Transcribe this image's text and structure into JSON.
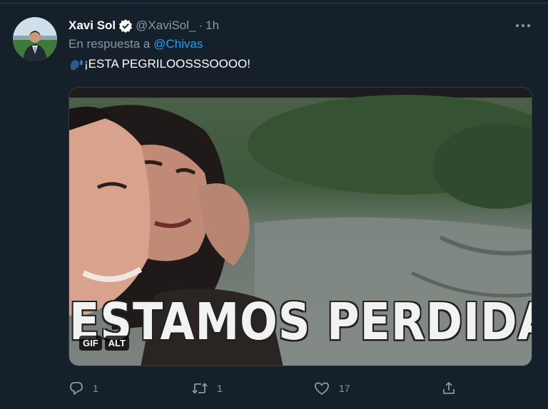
{
  "tweet": {
    "author_name": "Xavi Sol",
    "handle": "@XaviSol_",
    "separator": "·",
    "time": "1h",
    "reply_prefix": "En respuesta a",
    "reply_to": "@Chivas",
    "text": "¡ESTA PEGRILOOSSSOOOO!",
    "text_emoji": "speaking-head-icon"
  },
  "media": {
    "caption": "ESTAMOS PERDIDAS",
    "badges": [
      "GIF",
      "ALT"
    ]
  },
  "actions": {
    "reply_count": "1",
    "retweet_count": "1",
    "like_count": "17"
  },
  "colors": {
    "background": "#15202b",
    "secondary_text": "#8899a6",
    "link": "#1da1f2",
    "verified": "#ffffff"
  }
}
